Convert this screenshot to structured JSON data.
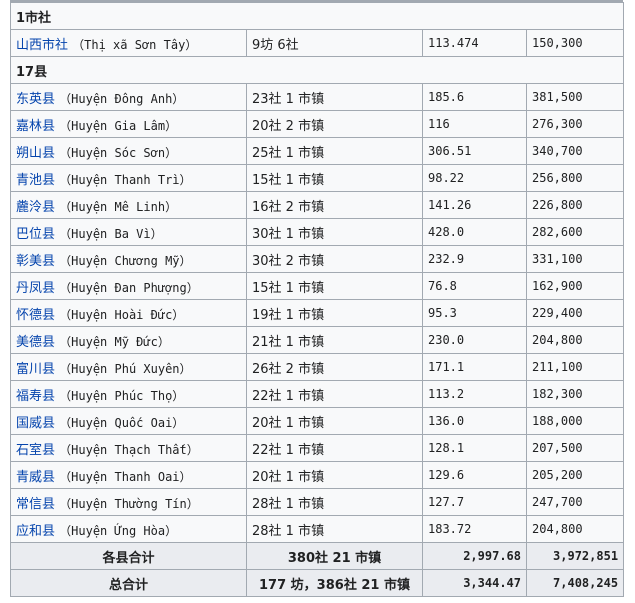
{
  "section_city": {
    "header": "1市社"
  },
  "city_rows": [
    {
      "name": "山西市社",
      "viet": "（Thị xã Sơn Tây）",
      "sub": "9坊 6社",
      "area": "113.474",
      "pop": "150,300"
    }
  ],
  "section_county": {
    "header": "17县"
  },
  "rows": [
    {
      "name": "东英县",
      "viet": "（Huyện Đông Anh）",
      "sub": "23社 1 市镇",
      "area": "185.6",
      "pop": "381,500"
    },
    {
      "name": "嘉林县",
      "viet": "（Huyện Gia Lâm）",
      "sub": "20社 2 市镇",
      "area": "116",
      "pop": "276,300"
    },
    {
      "name": "朔山县",
      "viet": "（Huyện Sóc Sơn）",
      "sub": "25社 1 市镇",
      "area": "306.51",
      "pop": "340,700"
    },
    {
      "name": "青池县",
      "viet": "（Huyện Thanh Trì）",
      "sub": "15社 1 市镇",
      "area": "98.22",
      "pop": "256,800"
    },
    {
      "name": "麊泠县",
      "viet": "（Huyện Mê Linh）",
      "sub": "16社 2 市镇",
      "area": "141.26",
      "pop": "226,800"
    },
    {
      "name": "巴位县",
      "viet": "（Huyện Ba Vì）",
      "sub": "30社 1 市镇",
      "area": "428.0",
      "pop": "282,600"
    },
    {
      "name": "彰美县",
      "viet": "（Huyện Chương Mỹ）",
      "sub": "30社 2 市镇",
      "area": "232.9",
      "pop": "331,100"
    },
    {
      "name": "丹凤县",
      "viet": "（Huyện Đan Phượng）",
      "sub": "15社 1 市镇",
      "area": "76.8",
      "pop": "162,900"
    },
    {
      "name": "怀德县",
      "viet": "（Huyện Hoài Đức）",
      "sub": "19社 1 市镇",
      "area": "95.3",
      "pop": "229,400"
    },
    {
      "name": "美德县",
      "viet": "（Huyện Mỹ Đức）",
      "sub": "21社 1 市镇",
      "area": "230.0",
      "pop": "204,800"
    },
    {
      "name": "富川县",
      "viet": "（Huyện Phú Xuyên）",
      "sub": "26社 2 市镇",
      "area": "171.1",
      "pop": "211,100"
    },
    {
      "name": "福寿县",
      "viet": "（Huyện Phúc Thọ）",
      "sub": "22社 1 市镇",
      "area": "113.2",
      "pop": "182,300"
    },
    {
      "name": "国威县",
      "viet": "（Huyện Quốc Oai）",
      "sub": "20社 1 市镇",
      "area": "136.0",
      "pop": "188,000"
    },
    {
      "name": "石室县",
      "viet": "（Huyện Thạch Thất）",
      "sub": "22社 1 市镇",
      "area": "128.1",
      "pop": "207,500"
    },
    {
      "name": "青威县",
      "viet": "（Huyện Thanh Oai）",
      "sub": "20社 1 市镇",
      "area": "129.6",
      "pop": "205,200"
    },
    {
      "name": "常信县",
      "viet": "（Huyện Thường Tín）",
      "sub": "28社 1 市镇",
      "area": "127.7",
      "pop": "247,700"
    },
    {
      "name": "应和县",
      "viet": "（Huyện Ứng Hòa）",
      "sub": "28社 1 市镇",
      "area": "183.72",
      "pop": "204,800"
    }
  ],
  "subtotal": {
    "label": "各县合计",
    "sub": "380社 21 市镇",
    "area": "2,997.68",
    "pop": "3,972,851"
  },
  "total": {
    "label": "总合计",
    "sub": "177 坊，386社 21 市镇",
    "area": "3,344.47",
    "pop": "7,408,245"
  },
  "colors": {
    "link": "#0645ad",
    "border": "#a2a9b1",
    "row_bg": "#f8f9fa",
    "total_bg": "#eaecf0"
  }
}
